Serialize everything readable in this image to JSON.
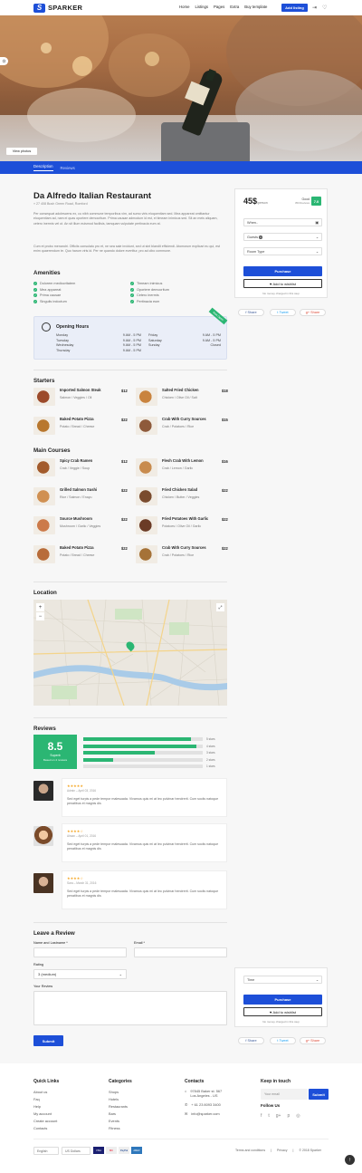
{
  "header": {
    "brand": "SPARKER",
    "nav": [
      "Home",
      "Listings",
      "Pages",
      "Extra",
      "Buy template"
    ],
    "add_listing": "Add listing"
  },
  "hero": {
    "view_photos": "View photos"
  },
  "tabs": [
    "Description",
    "Reviews"
  ],
  "listing": {
    "title": "Da Alfredo Italian Restaurant",
    "address": "27 408 Bush Green Road, Romford",
    "description_1": "Per consequat adolescens ex, cu nibh commune temporibus vim, ad sumo viris eloquentiam sed. Mea appareat omittantur eloquentiam ad, nam ei quas oportere democritum. Prima causae admodum id est, ei timeam inimicus sed. Sit an meis aliquam, cetero inermis vel ut. An sit illum euismod facilisis, tamquam vulputate pertinacia eum at.",
    "description_2": "Cum et probo menandri. Officiis consulatu pro et, ne sea sale invidunt, sed ut sint blandit efficiendi. Atomorum explicari eu qui, est enim quaerendum te. Quo harum viris id. Per ne quando dolore evertitur, pro ad cibo commune."
  },
  "amenities": {
    "title": "Amenities",
    "items": [
      "Dolorem mediocritatem",
      "Mea appareat",
      "Prima causae",
      "Singulis indoctum",
      "Timeam inimicus",
      "Oportere democritum",
      "Cetero inermis",
      "Pertinacia eum"
    ]
  },
  "hours": {
    "title": "Opening Hours",
    "badge": "Now Open",
    "rows": [
      [
        "Monday",
        "9 AM - 5 PM",
        "Friday",
        "9 AM - 5 PM"
      ],
      [
        "Tuesday",
        "9 AM - 5 PM",
        "Saturday",
        "9 AM - 5 PM"
      ],
      [
        "Wednesday",
        "9 AM - 5 PM",
        "Sunday",
        "Closed"
      ],
      [
        "Thursday",
        "9 AM - 5 PM",
        "",
        ""
      ]
    ]
  },
  "menu": {
    "starters_title": "Starters",
    "mains_title": "Main Courses",
    "starters": [
      {
        "name": "Imported Salmon Steak",
        "desc": "Salmon / Veggies / Oil",
        "price": "$12"
      },
      {
        "name": "Salted Fried Chicken",
        "desc": "Chicken / Olive Oil / Salt",
        "price": "$18"
      },
      {
        "name": "Baked Potato Pizza",
        "desc": "Potato / Bread / Cheese",
        "price": "$22"
      },
      {
        "name": "Crab With Curry Sources",
        "desc": "Crab / Potatoes / Rice",
        "price": "$15"
      }
    ],
    "mains": [
      {
        "name": "Spicy Crab Ramen",
        "desc": "Crab / Veggie / Soup",
        "price": "$12"
      },
      {
        "name": "Flesh Crab With Lemon",
        "desc": "Crab / Lemon / Garlic",
        "price": "$16"
      },
      {
        "name": "Grilled Salmon Sushi",
        "desc": "Rice / Salmon / Enayu",
        "price": "$22"
      },
      {
        "name": "Fried Chicken Salad",
        "desc": "Chicken / Butter / Veggies",
        "price": "$22"
      },
      {
        "name": "Source Mushroom",
        "desc": "Mushroom / Garlic / Veggies",
        "price": "$22"
      },
      {
        "name": "Fried Potatoes With Garlic",
        "desc": "Potatoes / Olive Oil / Garlic",
        "price": "$22"
      },
      {
        "name": "Baked Potato Pizza",
        "desc": "Potato / Bread / Cheese",
        "price": "$22"
      },
      {
        "name": "Crab With Curry Sources",
        "desc": "Crab / Potatoes / Rice",
        "price": "$22"
      }
    ]
  },
  "location": {
    "title": "Location"
  },
  "reviews": {
    "title": "Reviews",
    "score": "8.5",
    "score_label": "Superb",
    "score_sub": "Based on 4 reviews",
    "bars": [
      {
        "label": "5 stars",
        "fraction": 0.9
      },
      {
        "label": "4 stars",
        "fraction": 0.95
      },
      {
        "label": "3 stars",
        "fraction": 0.6
      },
      {
        "label": "2 stars",
        "fraction": 0.25
      },
      {
        "label": "1 stars",
        "fraction": 0.0
      }
    ],
    "items": [
      {
        "stars": "★★★★★",
        "meta": "Admin – April 03, 2016",
        "text": "Sed eget turpis a pede tempor malesuada. Vivamus quis mi at leo pulvinar hendrerit. Cum sociis natoque penatibus et magnis dis"
      },
      {
        "stars": "★★★★☆",
        "meta": "Ahsan – April 01, 2016",
        "text": "Sed eget turpis a pede tempor malesuada. Vivamus quis mi at leo pulvinar hendrerit. Cum sociis natoque penatibus et magnis dis"
      },
      {
        "stars": "★★★★☆",
        "meta": "Sara – March 31, 2016",
        "text": "Sed eget turpis a pede tempor malesuada. Vivamus quis mi at leo pulvinar hendrerit. Cum sociis natoque penatibus et magnis dis"
      }
    ]
  },
  "leave_review": {
    "title": "Leave a Review",
    "name_label": "Name and Lastname *",
    "email_label": "Email *",
    "rating_label": "Rating",
    "rating_value": "3 (medium)",
    "review_label": "Your Review",
    "submit": "Submit"
  },
  "booking": {
    "price": "45$",
    "per_person": "/person",
    "rating_label": "Good",
    "rating_sub": "350 Reviews",
    "rating_score": "7.0",
    "when": "When..",
    "guests": "Guests",
    "guests_count": "1",
    "room_type": "Room Type",
    "purchase": "Purchase",
    "wishlist": "Add to wishlist",
    "note": "No money charged in this step",
    "time": "Time"
  },
  "share": {
    "share": "Share",
    "tweet": "Tweet",
    "gshare": "Share"
  },
  "footer": {
    "quick_links_title": "Quick Links",
    "quick_links": [
      "About us",
      "Faq",
      "Help",
      "My account",
      "Create account",
      "Contacts"
    ],
    "categories_title": "Categories",
    "categories": [
      "Shops",
      "Hotels",
      "Restaurants",
      "Bars",
      "Events",
      "Fitness"
    ],
    "contacts_title": "Contacts",
    "address_line1": "97845 Baker st. 567",
    "address_line2": "Los Angeles - US",
    "phone": "+ 61 23 8093 3400",
    "email": "info@sparker.com",
    "touch_title": "Keep in touch",
    "email_placeholder": "Your email",
    "submit": "Submit",
    "follow_title": "Follow Us",
    "lang": "English",
    "currency": "US Dollars",
    "payments": [
      "VISA",
      "MC",
      "PayPal",
      "AMEX"
    ],
    "legal": [
      "Terms and conditions",
      "Privacy",
      "© 2018 Sparker"
    ]
  },
  "colors": {
    "primary": "#1d4fd8",
    "green": "#2bb673"
  }
}
